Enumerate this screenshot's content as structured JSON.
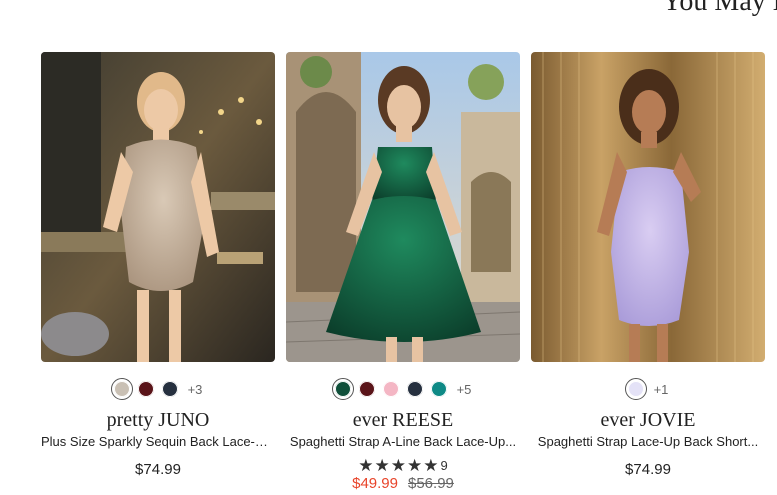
{
  "section_title": "You May L",
  "products": [
    {
      "brand": "pretty JUNO",
      "name": "Plus Size Sparkly Sequin Back Lace-U...",
      "price": "$74.99",
      "swatches": [
        "#c9c0b4",
        "#5a1419",
        "#26303f"
      ],
      "more_colors": "+3",
      "image_icon": "product-photo"
    },
    {
      "brand": "ever REESE",
      "name": "Spaghetti Strap A-Line Back Lace-Up...",
      "swatches": [
        "#0f4f3a",
        "#5a1419",
        "#f4b6c4",
        "#26303f",
        "#0e8a86"
      ],
      "more_colors": "+5",
      "rating_stars": 5,
      "rating_count": "9",
      "sale_price": "$49.99",
      "original_price": "$56.99",
      "image_icon": "product-photo"
    },
    {
      "brand": "ever JOVIE",
      "name": "Spaghetti Strap Lace-Up Back Short...",
      "price": "$74.99",
      "swatches": [
        "#e4e2f7"
      ],
      "more_colors": "+1",
      "image_icon": "product-photo"
    }
  ],
  "colors": {
    "sale": "#e8442a",
    "text": "#222222"
  }
}
